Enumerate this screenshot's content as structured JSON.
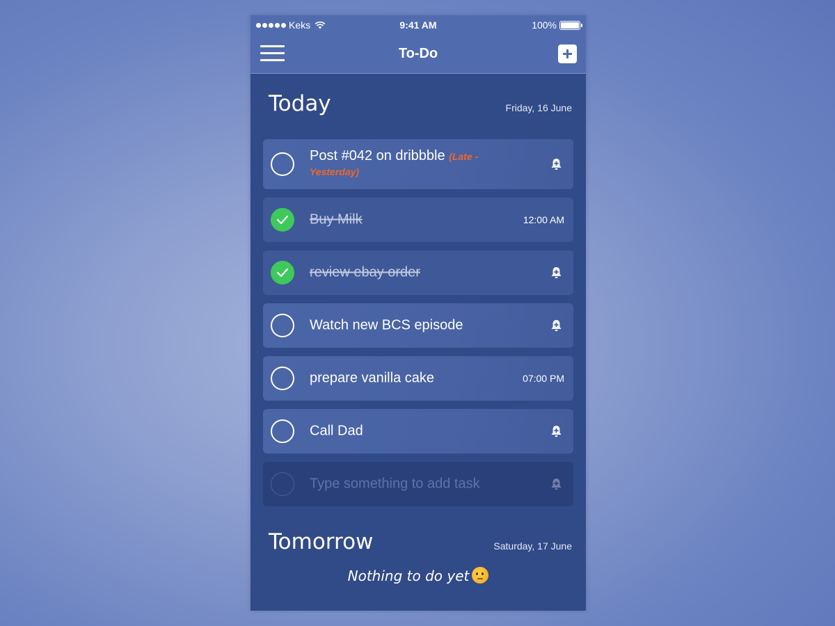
{
  "status_bar": {
    "carrier": "Keks",
    "time": "9:41 AM",
    "battery": "100%",
    "battery_level": 1.0
  },
  "navbar": {
    "title": "To-Do",
    "menu_icon": "hamburger-menu-icon",
    "add_icon": "plus-icon"
  },
  "today": {
    "title": "Today",
    "date": "Friday, 16 June",
    "tasks": [
      {
        "text": "Post #042 on dribbble",
        "note": "(Late - Yesterday)",
        "done": false,
        "right": "bell-plus-icon"
      },
      {
        "text": "Buy Milk",
        "done": true,
        "time": "12:00 AM"
      },
      {
        "text": "review ebay order",
        "done": true,
        "right": "bell-plus-icon"
      },
      {
        "text": "Watch new BCS episode",
        "done": false,
        "right": "bell-plus-icon"
      },
      {
        "text": "prepare vanilla cake",
        "done": false,
        "time": "07:00 PM"
      },
      {
        "text": "Call Dad",
        "done": false,
        "right": "bell-plus-icon"
      }
    ],
    "new_task_placeholder": "Type something to add task"
  },
  "tomorrow": {
    "title": "Tomorrow",
    "date": "Saturday, 17 June",
    "empty_text": "Nothing to do yet",
    "empty_emoji": "thinking-face-emoji"
  },
  "colors": {
    "accent_green": "#3ec95c",
    "late_orange": "#f0662a",
    "header_blue": "#516cae",
    "body_blue": "#314a88"
  }
}
